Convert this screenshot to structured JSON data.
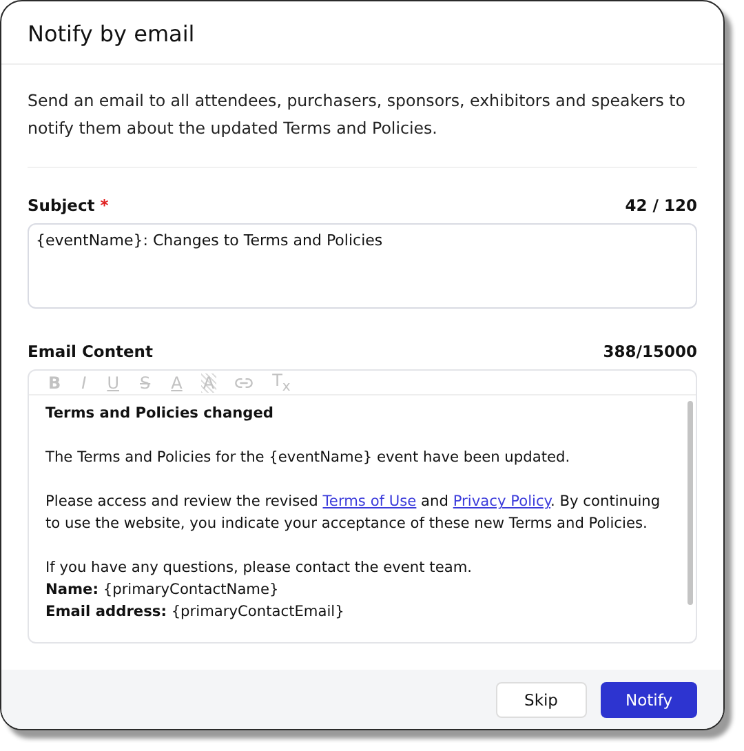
{
  "dialog": {
    "title": "Notify by email",
    "description": "Send an email to all attendees, purchasers, sponsors, exhibitors and speakers to notify them about the updated Terms and Policies."
  },
  "subject": {
    "label": "Subject",
    "required_mark": "*",
    "counter": "42 / 120",
    "value": "{eventName}: Changes to Terms and Policies"
  },
  "email_content": {
    "label": "Email Content",
    "counter": "388/15000",
    "toolbar": [
      {
        "kind": "bold",
        "label": "B"
      },
      {
        "kind": "italic",
        "label": "I"
      },
      {
        "kind": "underline",
        "label": "U"
      },
      {
        "kind": "strike",
        "label": "S"
      },
      {
        "kind": "font-color",
        "label": "A"
      },
      {
        "kind": "highlight",
        "label": "A"
      },
      {
        "kind": "link"
      },
      {
        "kind": "clear",
        "label": "T$_{x}$"
      }
    ],
    "paragraphs": [
      {
        "kind": "heading",
        "parts": [
          {
            "text": "Terms and Policies changed"
          }
        ]
      },
      {
        "kind": "text",
        "parts": [
          {
            "text": "The Terms and Policies for the {eventName} event have been updated."
          }
        ]
      },
      {
        "kind": "text",
        "parts": [
          {
            "text": "Please access and review the revised "
          },
          {
            "text": "Terms of Use",
            "link": true
          },
          {
            "text": " and "
          },
          {
            "text": "Privacy Policy",
            "link": true
          },
          {
            "text": ". By continuing to use the website, you indicate your acceptance of these new Terms and Policies."
          }
        ]
      },
      {
        "kind": "lines",
        "lines": [
          "If you have any questions, please contact the event team.",
          "**Name:** {primaryContactName}",
          "**Email address:** {primaryContactEmail}"
        ]
      }
    ]
  },
  "buttons": [
    {
      "label": "Skip",
      "kind": "secondary"
    },
    {
      "label": "Notify",
      "kind": "primary"
    }
  ]
}
